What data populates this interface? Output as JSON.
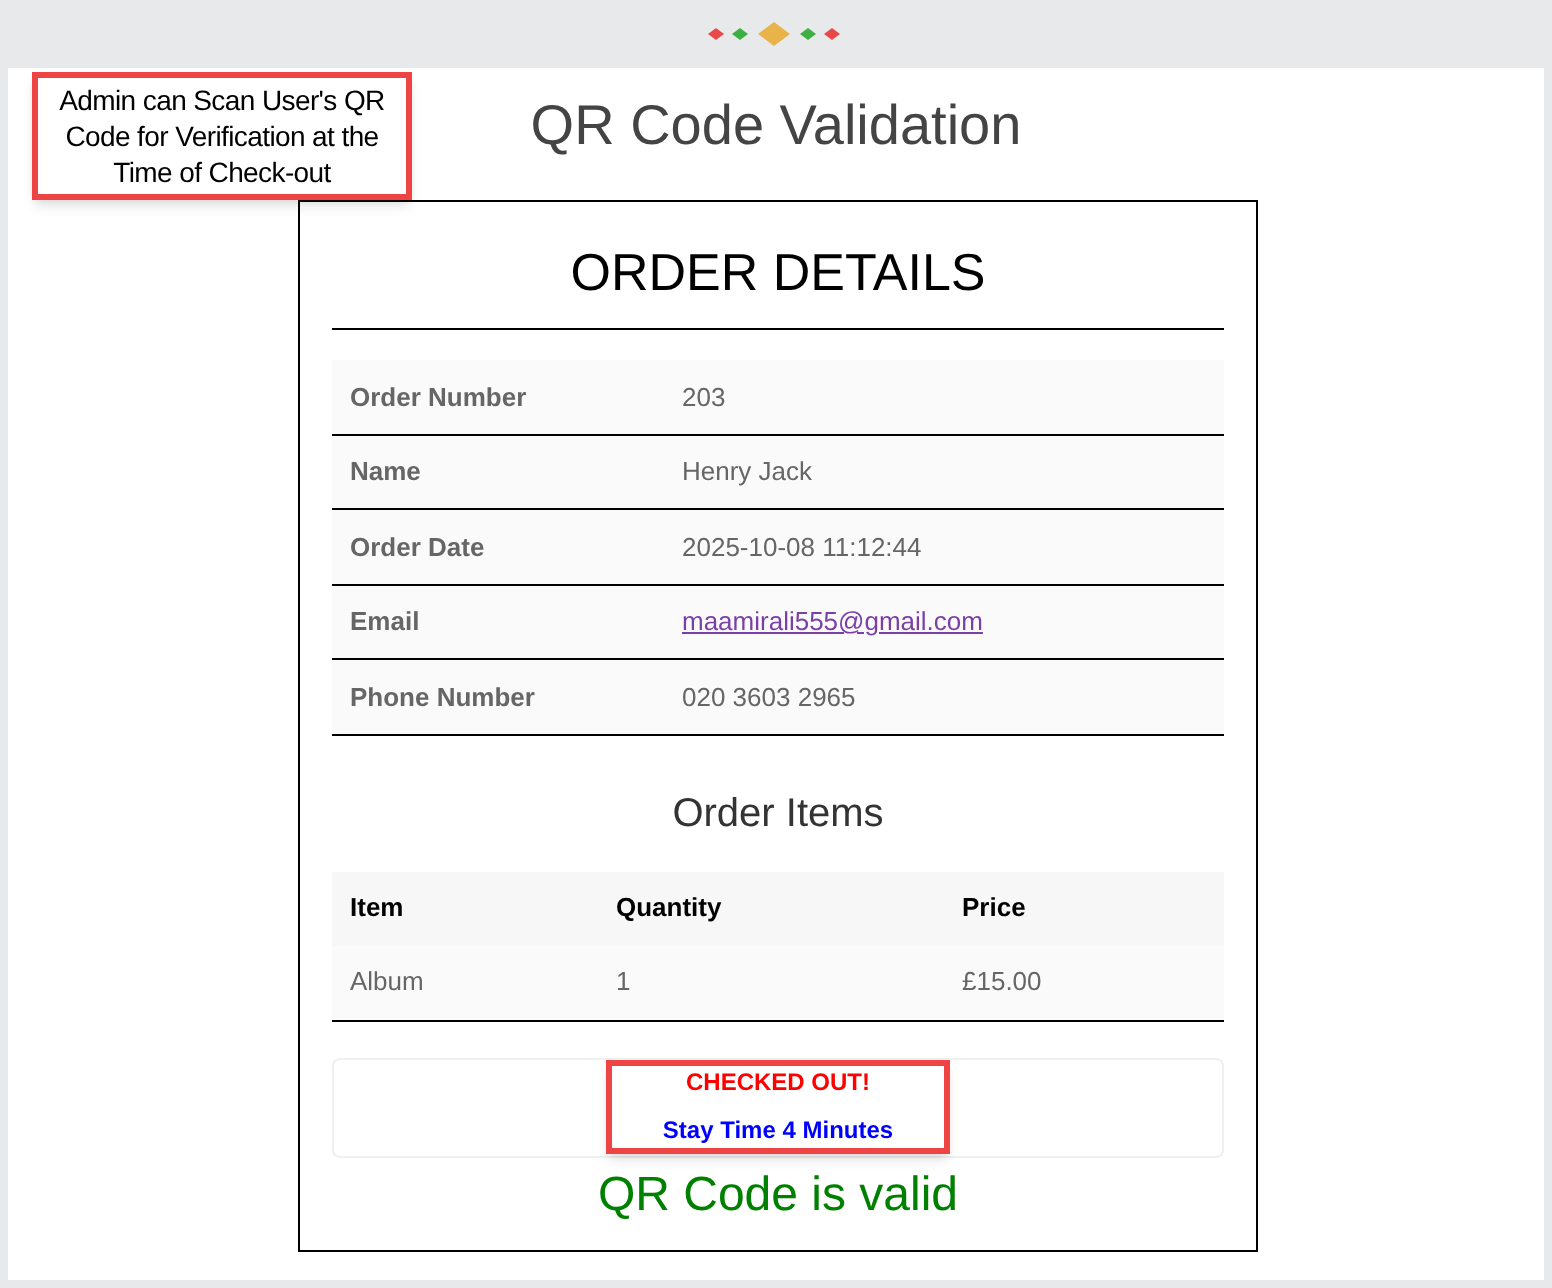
{
  "annotation": {
    "text": "Admin can Scan User's QR Code for Verification at the Time of Check-out"
  },
  "title": "QR Code Validation",
  "card": {
    "heading": "ORDER DETAILS",
    "details": [
      {
        "label": "Order Number",
        "value": "203",
        "kind": "text"
      },
      {
        "label": "Name",
        "value": "Henry Jack",
        "kind": "text"
      },
      {
        "label": "Order Date",
        "value": "2025-10-08 11:12:44",
        "kind": "text"
      },
      {
        "label": "Email",
        "value": "maamirali555@gmail.com",
        "kind": "link"
      },
      {
        "label": "Phone Number",
        "value": "020 3603 2965",
        "kind": "text"
      }
    ],
    "items_heading": "Order Items",
    "items_table": {
      "columns": [
        "Item",
        "Quantity",
        "Price"
      ],
      "rows": [
        [
          "Album",
          "1",
          "£15.00"
        ]
      ]
    },
    "status": [
      {
        "text": "CHECKED OUT!",
        "kind": "alert"
      },
      {
        "text": "Stay Time 4 Minutes",
        "kind": "info"
      }
    ],
    "validity": "QR Code is valid"
  }
}
